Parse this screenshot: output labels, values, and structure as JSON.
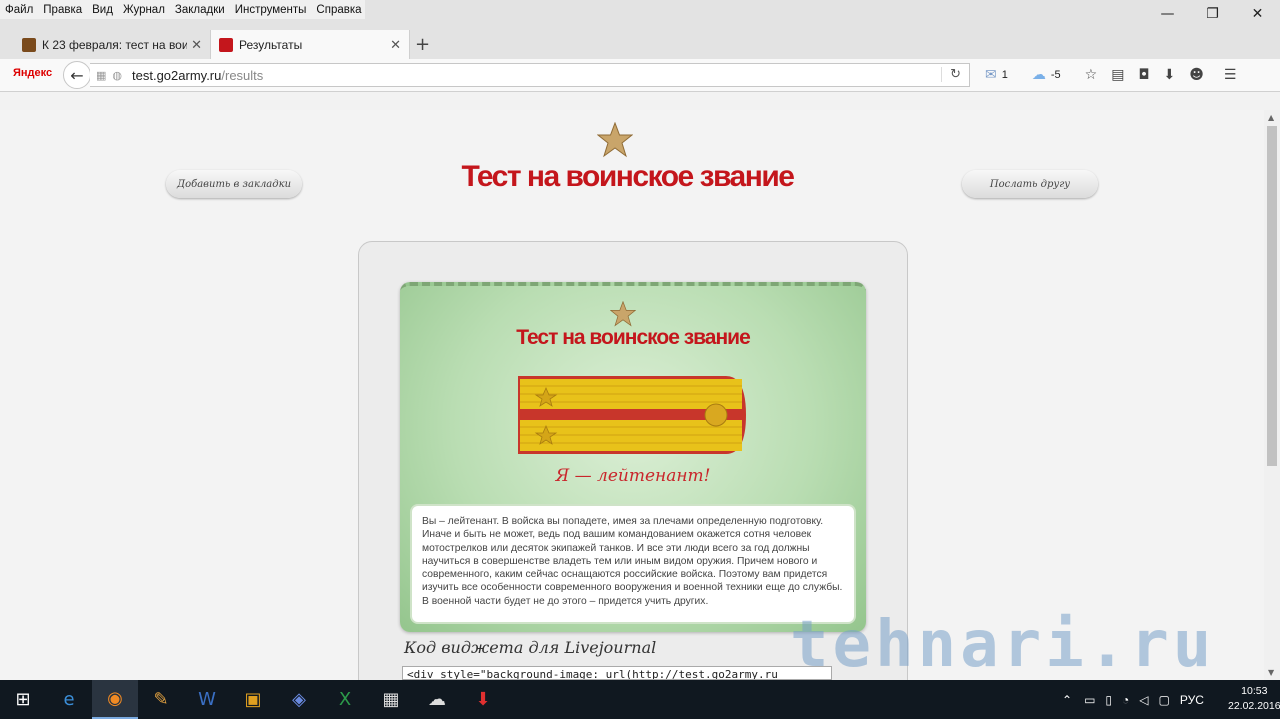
{
  "menu": [
    "Файл",
    "Правка",
    "Вид",
    "Журнал",
    "Закладки",
    "Инструменты",
    "Справка"
  ],
  "window_controls": {
    "minimize": "—",
    "restore": "❐",
    "close": "✕"
  },
  "tabs": [
    {
      "title": "К 23 февраля: тест на вои...",
      "close": "✕",
      "favicon_color": "#7a4a1c"
    },
    {
      "title": "Результаты",
      "close": "✕",
      "favicon_color": "#c4161c"
    }
  ],
  "new_tab": "+",
  "toolbar": {
    "yandex": "Яндекс",
    "back": "←",
    "url_host": "test.go2army.ru",
    "url_path": "/results",
    "mail_count": "1",
    "weather": "-5"
  },
  "page": {
    "title": "Тест на воинское звание",
    "bookmark_button": "Добавить в закладки",
    "send_button": "Послать другу",
    "card_title": "Тест на воинское звание",
    "result": "Я — лейтенант!",
    "description": "Вы – лейтенант. В войска вы попадете, имея за плечами определенную подготовку. Иначе и быть не может, ведь под вашим командованием окажется сотня человек мотострелков или десяток экипажей танков. И все эти люди всего за год должны научиться в совершенстве владеть тем или иным видом оружия. Причем нового и современного, каким сейчас оснащаются российские войска. Поэтому вам придется изучить все особенности современного вооружения и военной техники еще до службы. В военной части будет не до этого – придется учить других.",
    "widget_heading": "Код виджета для Livejournal",
    "widget_code": "<div style=\"background-image: url(http://test.go2army.ru"
  },
  "watermark": "tehnari.ru",
  "tray": {
    "lang": "РУС",
    "time": "10:53",
    "date": "22.02.2016"
  },
  "colors": {
    "brand_red": "#c4161c",
    "card_green": "#b9ddb2",
    "gold": "#e8c21a"
  }
}
